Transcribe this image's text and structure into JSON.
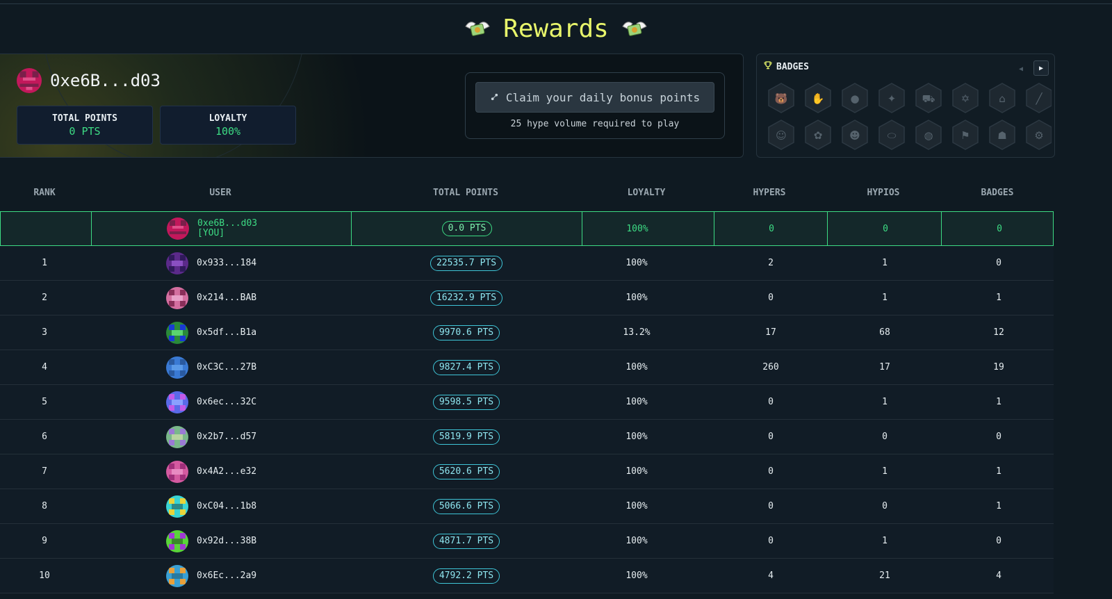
{
  "title": "Rewards",
  "profile": {
    "address": "0xe6B...d03",
    "total_points_label": "TOTAL POINTS",
    "total_points_value": "0 PTS",
    "loyalty_label": "LOYALTY",
    "loyalty_value": "100%"
  },
  "claim": {
    "button_label": "Claim your daily bonus points",
    "note": "25 hype volume required to play"
  },
  "badges": {
    "title": "BADGES",
    "icons": [
      "bear-badge-icon",
      "hand-badge-icon",
      "circle-badge-icon",
      "wing-badge-icon",
      "truck-badge-icon",
      "star-of-david-badge-icon",
      "house-badge-icon",
      "stick-badge-icon",
      "robot-badge-icon",
      "flower-badge-icon",
      "cat-badge-icon",
      "pill-badge-icon",
      "rock-badge-icon",
      "flag-badge-icon",
      "ghost-badge-icon",
      "gear-badge-icon"
    ]
  },
  "table": {
    "headers": {
      "rank": "RANK",
      "user": "USER",
      "points": "TOTAL POINTS",
      "loyalty": "LOYALTY",
      "hypers": "HYPERS",
      "hypios": "HYPIOS",
      "badges": "BADGES"
    },
    "me": {
      "rank": "",
      "user": "0xe6B...d03",
      "you_tag": "[YOU]",
      "points": "0.0 PTS",
      "loyalty": "100%",
      "hypers": "0",
      "hypios": "0",
      "badges": "0"
    },
    "rows": [
      {
        "rank": "1",
        "user": "0x933...184",
        "points": "22535.7 PTS",
        "loyalty": "100%",
        "hypers": "2",
        "hypios": "1",
        "badges": "0"
      },
      {
        "rank": "2",
        "user": "0x214...BAB",
        "points": "16232.9 PTS",
        "loyalty": "100%",
        "hypers": "0",
        "hypios": "1",
        "badges": "1"
      },
      {
        "rank": "3",
        "user": "0x5df...B1a",
        "points": "9970.6 PTS",
        "loyalty": "13.2%",
        "hypers": "17",
        "hypios": "68",
        "badges": "12"
      },
      {
        "rank": "4",
        "user": "0xC3C...27B",
        "points": "9827.4 PTS",
        "loyalty": "100%",
        "hypers": "260",
        "hypios": "17",
        "badges": "19"
      },
      {
        "rank": "5",
        "user": "0x6ec...32C",
        "points": "9598.5 PTS",
        "loyalty": "100%",
        "hypers": "0",
        "hypios": "1",
        "badges": "1"
      },
      {
        "rank": "6",
        "user": "0x2b7...d57",
        "points": "5819.9 PTS",
        "loyalty": "100%",
        "hypers": "0",
        "hypios": "0",
        "badges": "0"
      },
      {
        "rank": "7",
        "user": "0x4A2...e32",
        "points": "5620.6 PTS",
        "loyalty": "100%",
        "hypers": "0",
        "hypios": "1",
        "badges": "1"
      },
      {
        "rank": "8",
        "user": "0xC04...1b8",
        "points": "5066.6 PTS",
        "loyalty": "100%",
        "hypers": "0",
        "hypios": "0",
        "badges": "1"
      },
      {
        "rank": "9",
        "user": "0x92d...38B",
        "points": "4871.7 PTS",
        "loyalty": "100%",
        "hypers": "0",
        "hypios": "1",
        "badges": "0"
      },
      {
        "rank": "10",
        "user": "0x6Ec...2a9",
        "points": "4792.2 PTS",
        "loyalty": "100%",
        "hypers": "4",
        "hypios": "21",
        "badges": "4"
      }
    ]
  },
  "colors": {
    "accent_green": "#3ddc84",
    "accent_cyan": "#3fc6d8",
    "title_yellow": "#e8f56b",
    "danger_red": "#f04a4a"
  }
}
